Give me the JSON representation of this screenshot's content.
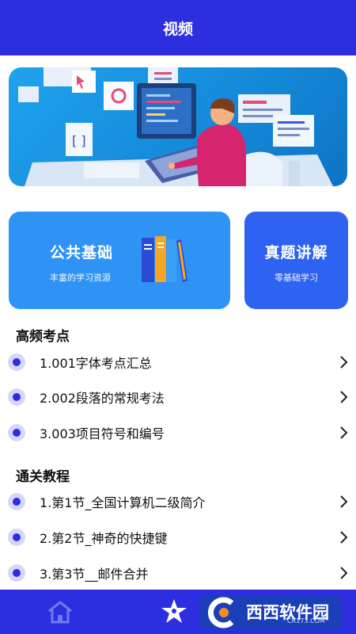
{
  "header": {
    "title": "视频"
  },
  "cards": {
    "public": {
      "title": "公共基础",
      "subtitle": "丰富的学习资源"
    },
    "exam": {
      "title": "真题讲解",
      "subtitle": "零基础学习"
    }
  },
  "sections": [
    {
      "title": "高频考点",
      "items": [
        "1.001字体考点汇总",
        "2.002段落的常规考法",
        "3.003项目符号和编号"
      ]
    },
    {
      "title": "通关教程",
      "items": [
        "1.第1节_全国计算机二级简介",
        "2.第2节_神奇的快捷键",
        "3.第3节__邮件合并"
      ]
    }
  ],
  "tabbar": {
    "icons": [
      "home-icon",
      "star-person-icon"
    ]
  },
  "watermark": {
    "text": "西西软件园",
    "sub": "CR173.COM"
  },
  "colors": {
    "primary": "#2d2ee0",
    "card_blue": "#2f93f5",
    "card_royal": "#2e62f0"
  }
}
